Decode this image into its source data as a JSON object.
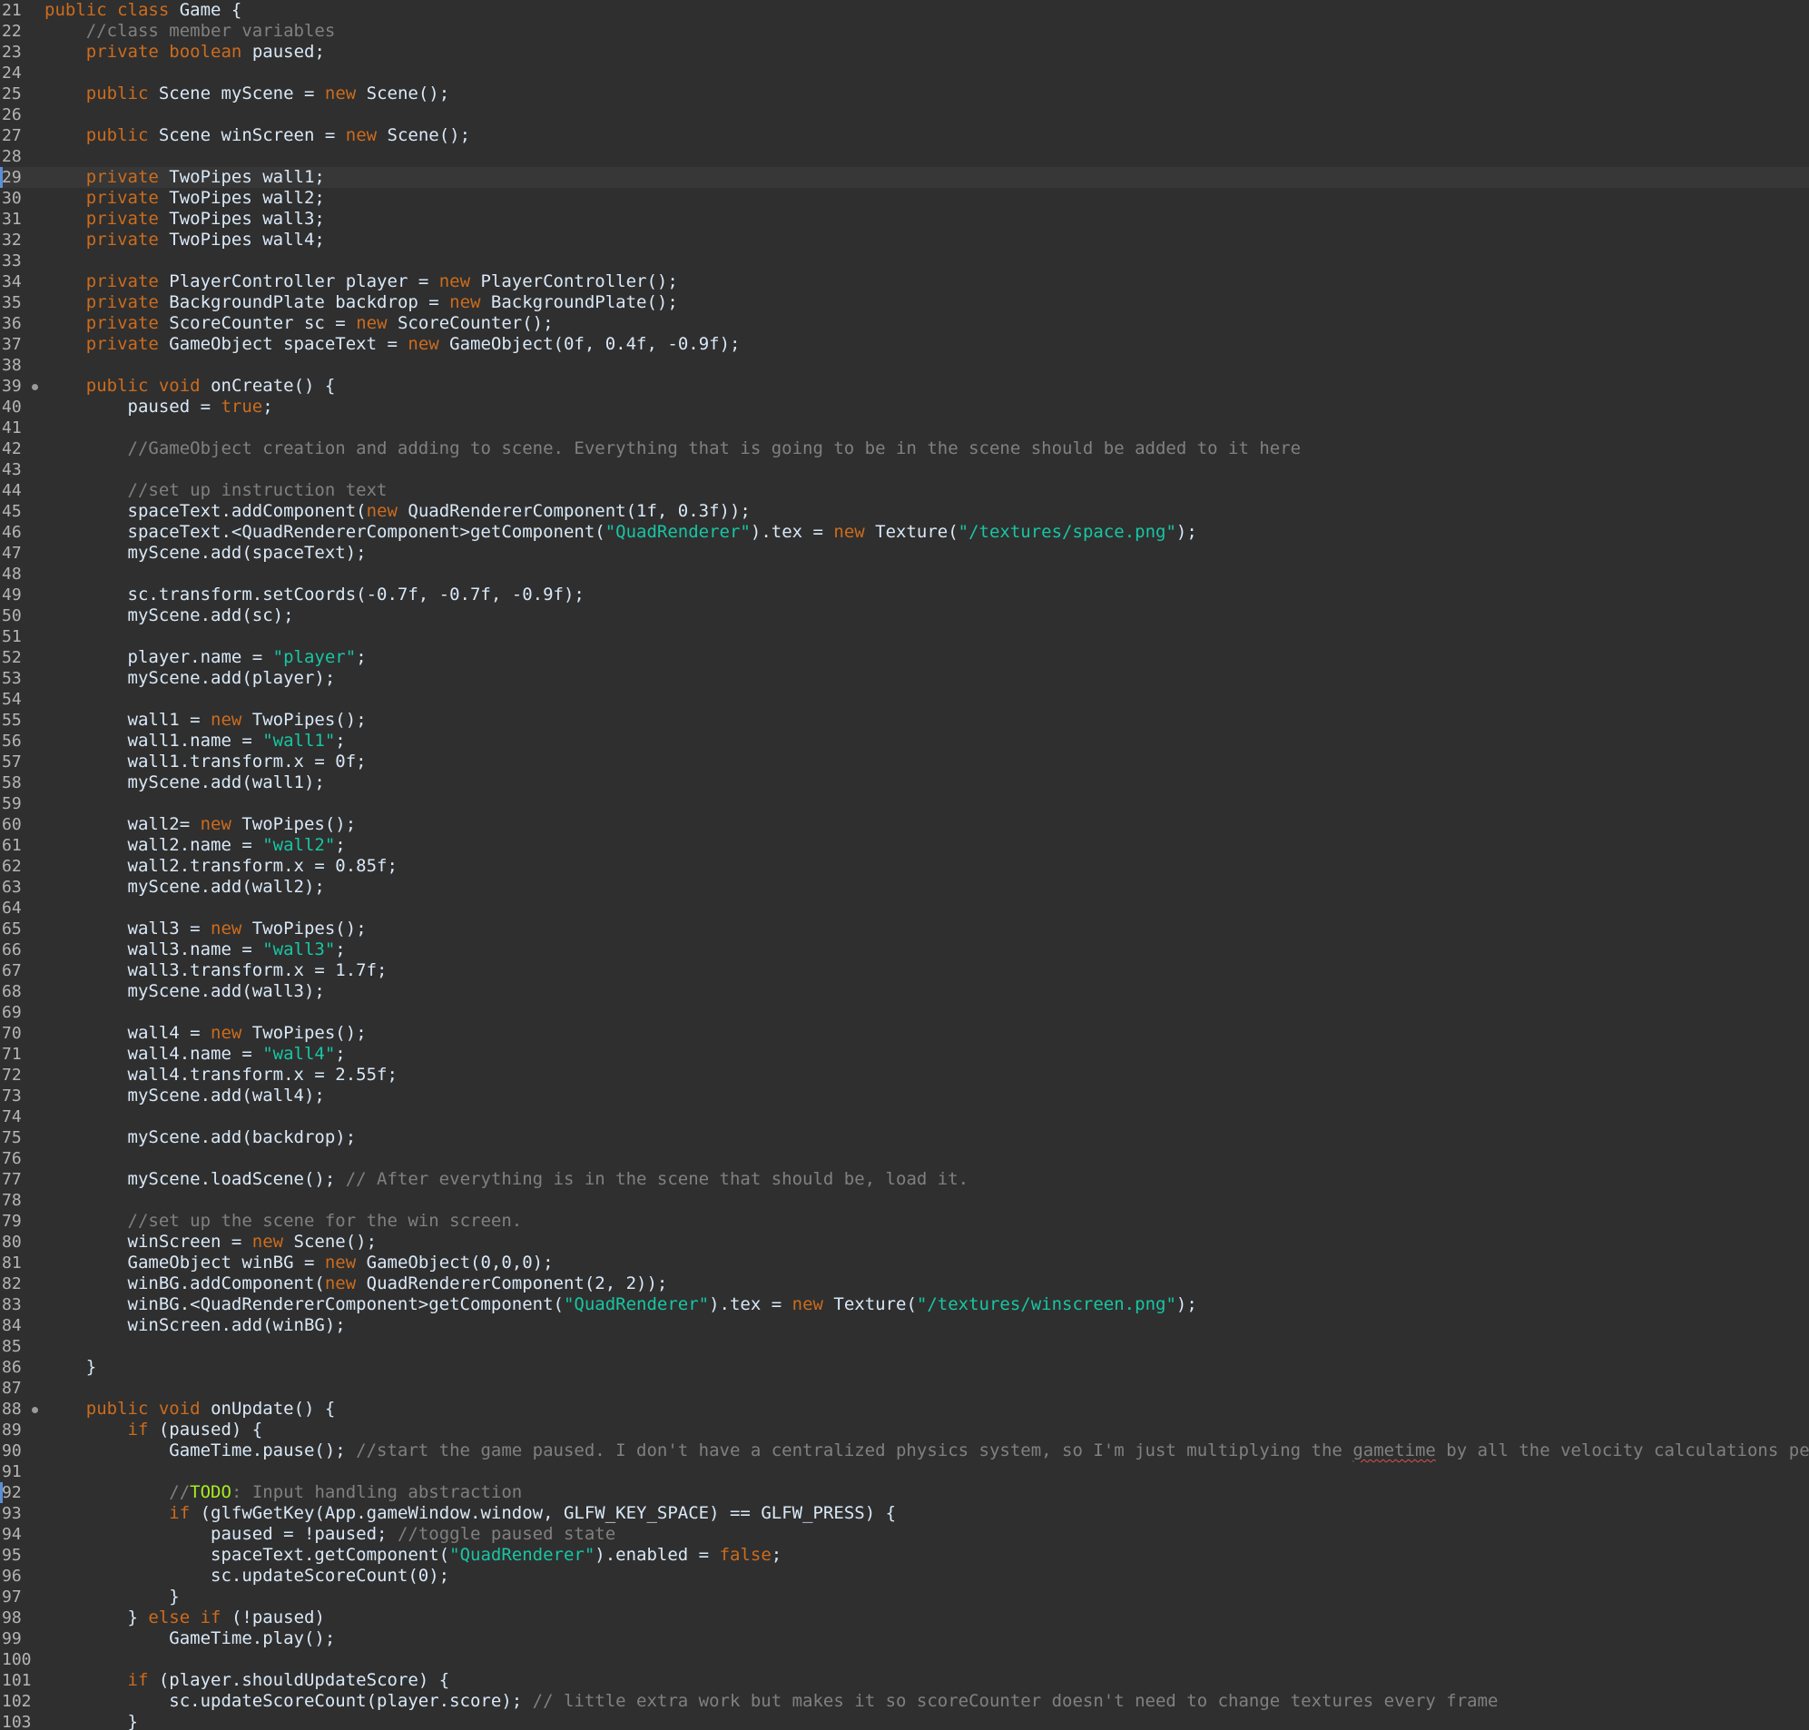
{
  "editor": {
    "current_line": 29,
    "lines": [
      {
        "n": "21",
        "t": [
          [
            "kw",
            "public"
          ],
          [
            "p",
            " "
          ],
          [
            "kw",
            "class"
          ],
          [
            "p",
            " Game {"
          ]
        ]
      },
      {
        "n": "22",
        "t": [
          [
            "p",
            "    "
          ],
          [
            "cm",
            "//class member variables"
          ]
        ]
      },
      {
        "n": "23",
        "t": [
          [
            "p",
            "    "
          ],
          [
            "kw",
            "private"
          ],
          [
            "p",
            " "
          ],
          [
            "kw",
            "boolean"
          ],
          [
            "p",
            " paused;"
          ]
        ]
      },
      {
        "n": "24",
        "t": []
      },
      {
        "n": "25",
        "t": [
          [
            "p",
            "    "
          ],
          [
            "kw",
            "public"
          ],
          [
            "p",
            " Scene myScene = "
          ],
          [
            "kw",
            "new"
          ],
          [
            "p",
            " Scene();"
          ]
        ]
      },
      {
        "n": "26",
        "t": []
      },
      {
        "n": "27",
        "t": [
          [
            "p",
            "    "
          ],
          [
            "kw",
            "public"
          ],
          [
            "p",
            " Scene winScreen = "
          ],
          [
            "kw",
            "new"
          ],
          [
            "p",
            " Scene();"
          ]
        ]
      },
      {
        "n": "28",
        "t": []
      },
      {
        "n": "29",
        "t": [
          [
            "p",
            "    "
          ],
          [
            "kw",
            "private"
          ],
          [
            "p",
            " TwoPipes wall1;"
          ]
        ],
        "current": true,
        "marker": true
      },
      {
        "n": "30",
        "t": [
          [
            "p",
            "    "
          ],
          [
            "kw",
            "private"
          ],
          [
            "p",
            " TwoPipes wall2;"
          ]
        ]
      },
      {
        "n": "31",
        "t": [
          [
            "p",
            "    "
          ],
          [
            "kw",
            "private"
          ],
          [
            "p",
            " TwoPipes wall3;"
          ]
        ]
      },
      {
        "n": "32",
        "t": [
          [
            "p",
            "    "
          ],
          [
            "kw",
            "private"
          ],
          [
            "p",
            " TwoPipes wall4;"
          ]
        ]
      },
      {
        "n": "33",
        "t": []
      },
      {
        "n": "34",
        "t": [
          [
            "p",
            "    "
          ],
          [
            "kw",
            "private"
          ],
          [
            "p",
            " PlayerController player = "
          ],
          [
            "kw",
            "new"
          ],
          [
            "p",
            " PlayerController();"
          ]
        ]
      },
      {
        "n": "35",
        "t": [
          [
            "p",
            "    "
          ],
          [
            "kw",
            "private"
          ],
          [
            "p",
            " BackgroundPlate backdrop = "
          ],
          [
            "kw",
            "new"
          ],
          [
            "p",
            " BackgroundPlate();"
          ]
        ]
      },
      {
        "n": "36",
        "t": [
          [
            "p",
            "    "
          ],
          [
            "kw",
            "private"
          ],
          [
            "p",
            " ScoreCounter sc = "
          ],
          [
            "kw",
            "new"
          ],
          [
            "p",
            " ScoreCounter();"
          ]
        ]
      },
      {
        "n": "37",
        "t": [
          [
            "p",
            "    "
          ],
          [
            "kw",
            "private"
          ],
          [
            "p",
            " GameObject spaceText = "
          ],
          [
            "kw",
            "new"
          ],
          [
            "p",
            " GameObject(0f, 0.4f, -0.9f);"
          ]
        ]
      },
      {
        "n": "38",
        "t": []
      },
      {
        "n": "39",
        "t": [
          [
            "p",
            "    "
          ],
          [
            "kw",
            "public"
          ],
          [
            "p",
            " "
          ],
          [
            "kw",
            "void"
          ],
          [
            "p",
            " onCreate() {"
          ]
        ],
        "fold": true
      },
      {
        "n": "40",
        "t": [
          [
            "p",
            "        paused = "
          ],
          [
            "kw",
            "true"
          ],
          [
            "p",
            ";"
          ]
        ]
      },
      {
        "n": "41",
        "t": []
      },
      {
        "n": "42",
        "t": [
          [
            "p",
            "        "
          ],
          [
            "cm",
            "//GameObject creation and adding to scene. Everything that is going to be in the scene should be added to it here"
          ]
        ]
      },
      {
        "n": "43",
        "t": []
      },
      {
        "n": "44",
        "t": [
          [
            "p",
            "        "
          ],
          [
            "cm",
            "//set up instruction text"
          ]
        ]
      },
      {
        "n": "45",
        "t": [
          [
            "p",
            "        spaceText.addComponent("
          ],
          [
            "kw",
            "new"
          ],
          [
            "p",
            " QuadRendererComponent(1f, 0.3f));"
          ]
        ]
      },
      {
        "n": "46",
        "t": [
          [
            "p",
            "        spaceText.<QuadRendererComponent>getComponent("
          ],
          [
            "str",
            "\"QuadRenderer\""
          ],
          [
            "p",
            ").tex = "
          ],
          [
            "kw",
            "new"
          ],
          [
            "p",
            " Texture("
          ],
          [
            "str",
            "\"/textures/space.png\""
          ],
          [
            "p",
            ");"
          ]
        ]
      },
      {
        "n": "47",
        "t": [
          [
            "p",
            "        myScene.add(spaceText);"
          ]
        ]
      },
      {
        "n": "48",
        "t": []
      },
      {
        "n": "49",
        "t": [
          [
            "p",
            "        sc.transform.setCoords(-0.7f, -0.7f, -0.9f);"
          ]
        ]
      },
      {
        "n": "50",
        "t": [
          [
            "p",
            "        myScene.add(sc);"
          ]
        ]
      },
      {
        "n": "51",
        "t": []
      },
      {
        "n": "52",
        "t": [
          [
            "p",
            "        player.name = "
          ],
          [
            "str",
            "\"player\""
          ],
          [
            "p",
            ";"
          ]
        ]
      },
      {
        "n": "53",
        "t": [
          [
            "p",
            "        myScene.add(player);"
          ]
        ]
      },
      {
        "n": "54",
        "t": []
      },
      {
        "n": "55",
        "t": [
          [
            "p",
            "        wall1 = "
          ],
          [
            "kw",
            "new"
          ],
          [
            "p",
            " TwoPipes();"
          ]
        ]
      },
      {
        "n": "56",
        "t": [
          [
            "p",
            "        wall1.name = "
          ],
          [
            "str",
            "\"wall1\""
          ],
          [
            "p",
            ";"
          ]
        ]
      },
      {
        "n": "57",
        "t": [
          [
            "p",
            "        wall1.transform.x = 0f;"
          ]
        ]
      },
      {
        "n": "58",
        "t": [
          [
            "p",
            "        myScene.add(wall1);"
          ]
        ]
      },
      {
        "n": "59",
        "t": []
      },
      {
        "n": "60",
        "t": [
          [
            "p",
            "        wall2= "
          ],
          [
            "kw",
            "new"
          ],
          [
            "p",
            " TwoPipes();"
          ]
        ]
      },
      {
        "n": "61",
        "t": [
          [
            "p",
            "        wall2.name = "
          ],
          [
            "str",
            "\"wall2\""
          ],
          [
            "p",
            ";"
          ]
        ]
      },
      {
        "n": "62",
        "t": [
          [
            "p",
            "        wall2.transform.x = 0.85f;"
          ]
        ]
      },
      {
        "n": "63",
        "t": [
          [
            "p",
            "        myScene.add(wall2);"
          ]
        ]
      },
      {
        "n": "64",
        "t": []
      },
      {
        "n": "65",
        "t": [
          [
            "p",
            "        wall3 = "
          ],
          [
            "kw",
            "new"
          ],
          [
            "p",
            " TwoPipes();"
          ]
        ]
      },
      {
        "n": "66",
        "t": [
          [
            "p",
            "        wall3.name = "
          ],
          [
            "str",
            "\"wall3\""
          ],
          [
            "p",
            ";"
          ]
        ]
      },
      {
        "n": "67",
        "t": [
          [
            "p",
            "        wall3.transform.x = 1.7f;"
          ]
        ]
      },
      {
        "n": "68",
        "t": [
          [
            "p",
            "        myScene.add(wall3);"
          ]
        ]
      },
      {
        "n": "69",
        "t": []
      },
      {
        "n": "70",
        "t": [
          [
            "p",
            "        wall4 = "
          ],
          [
            "kw",
            "new"
          ],
          [
            "p",
            " TwoPipes();"
          ]
        ]
      },
      {
        "n": "71",
        "t": [
          [
            "p",
            "        wall4.name = "
          ],
          [
            "str",
            "\"wall4\""
          ],
          [
            "p",
            ";"
          ]
        ]
      },
      {
        "n": "72",
        "t": [
          [
            "p",
            "        wall4.transform.x = 2.55f;"
          ]
        ]
      },
      {
        "n": "73",
        "t": [
          [
            "p",
            "        myScene.add(wall4);"
          ]
        ]
      },
      {
        "n": "74",
        "t": []
      },
      {
        "n": "75",
        "t": [
          [
            "p",
            "        myScene.add(backdrop);"
          ]
        ]
      },
      {
        "n": "76",
        "t": []
      },
      {
        "n": "77",
        "t": [
          [
            "p",
            "        myScene.loadScene(); "
          ],
          [
            "cm",
            "// After everything is in the scene that should be, load it."
          ]
        ]
      },
      {
        "n": "78",
        "t": []
      },
      {
        "n": "79",
        "t": [
          [
            "p",
            "        "
          ],
          [
            "cm",
            "//set up the scene for the win screen."
          ]
        ]
      },
      {
        "n": "80",
        "t": [
          [
            "p",
            "        winScreen = "
          ],
          [
            "kw",
            "new"
          ],
          [
            "p",
            " Scene();"
          ]
        ]
      },
      {
        "n": "81",
        "t": [
          [
            "p",
            "        GameObject winBG = "
          ],
          [
            "kw",
            "new"
          ],
          [
            "p",
            " GameObject(0,0,0);"
          ]
        ]
      },
      {
        "n": "82",
        "t": [
          [
            "p",
            "        winBG.addComponent("
          ],
          [
            "kw",
            "new"
          ],
          [
            "p",
            " QuadRendererComponent(2, 2));"
          ]
        ]
      },
      {
        "n": "83",
        "t": [
          [
            "p",
            "        winBG.<QuadRendererComponent>getComponent("
          ],
          [
            "str",
            "\"QuadRenderer\""
          ],
          [
            "p",
            ").tex = "
          ],
          [
            "kw",
            "new"
          ],
          [
            "p",
            " Texture("
          ],
          [
            "str",
            "\"/textures/winscreen.png\""
          ],
          [
            "p",
            ");"
          ]
        ]
      },
      {
        "n": "84",
        "t": [
          [
            "p",
            "        winScreen.add(winBG);"
          ]
        ]
      },
      {
        "n": "85",
        "t": []
      },
      {
        "n": "86",
        "t": [
          [
            "p",
            "    }"
          ]
        ]
      },
      {
        "n": "87",
        "t": []
      },
      {
        "n": "88",
        "t": [
          [
            "p",
            "    "
          ],
          [
            "kw",
            "public"
          ],
          [
            "p",
            " "
          ],
          [
            "kw",
            "void"
          ],
          [
            "p",
            " onUpdate() {"
          ]
        ],
        "fold": true
      },
      {
        "n": "89",
        "t": [
          [
            "p",
            "        "
          ],
          [
            "kw",
            "if"
          ],
          [
            "p",
            " (paused) {"
          ]
        ]
      },
      {
        "n": "90",
        "t": [
          [
            "p",
            "            GameTime.pause(); "
          ],
          [
            "cm",
            "//start the game paused. I don't have a centralized physics system, so I'm just multiplying the "
          ],
          [
            "cmu",
            "gametime"
          ],
          [
            "cm",
            " by all the velocity calculations per object"
          ]
        ]
      },
      {
        "n": "91",
        "t": []
      },
      {
        "n": "92",
        "t": [
          [
            "p",
            "            "
          ],
          [
            "cm",
            "//"
          ],
          [
            "todo",
            "TODO"
          ],
          [
            "cm",
            ": Input handling abstraction"
          ]
        ],
        "marker": true
      },
      {
        "n": "93",
        "t": [
          [
            "p",
            "            "
          ],
          [
            "kw",
            "if"
          ],
          [
            "p",
            " (glfwGetKey(App.gameWindow.window, GLFW_KEY_SPACE) == GLFW_PRESS) {"
          ]
        ]
      },
      {
        "n": "94",
        "t": [
          [
            "p",
            "                paused = !paused; "
          ],
          [
            "cm",
            "//toggle paused state"
          ]
        ]
      },
      {
        "n": "95",
        "t": [
          [
            "p",
            "                spaceText.getComponent("
          ],
          [
            "str",
            "\"QuadRenderer\""
          ],
          [
            "p",
            ").enabled = "
          ],
          [
            "kw",
            "false"
          ],
          [
            "p",
            ";"
          ]
        ]
      },
      {
        "n": "96",
        "t": [
          [
            "p",
            "                sc.updateScoreCount(0);"
          ]
        ]
      },
      {
        "n": "97",
        "t": [
          [
            "p",
            "            }"
          ]
        ]
      },
      {
        "n": "98",
        "t": [
          [
            "p",
            "        } "
          ],
          [
            "kw",
            "else"
          ],
          [
            "p",
            " "
          ],
          [
            "kw",
            "if"
          ],
          [
            "p",
            " (!paused)"
          ]
        ]
      },
      {
        "n": "99",
        "t": [
          [
            "p",
            "            GameTime.play();"
          ]
        ]
      },
      {
        "n": "100",
        "t": []
      },
      {
        "n": "101",
        "t": [
          [
            "p",
            "        "
          ],
          [
            "kw",
            "if"
          ],
          [
            "p",
            " (player.shouldUpdateScore) {"
          ]
        ]
      },
      {
        "n": "102",
        "t": [
          [
            "p",
            "            sc.updateScoreCount(player.score); "
          ],
          [
            "cm",
            "// little extra work but makes it so scoreCounter doesn't need to change textures every frame"
          ]
        ]
      },
      {
        "n": "103",
        "t": [
          [
            "p",
            "        }"
          ]
        ]
      }
    ]
  }
}
